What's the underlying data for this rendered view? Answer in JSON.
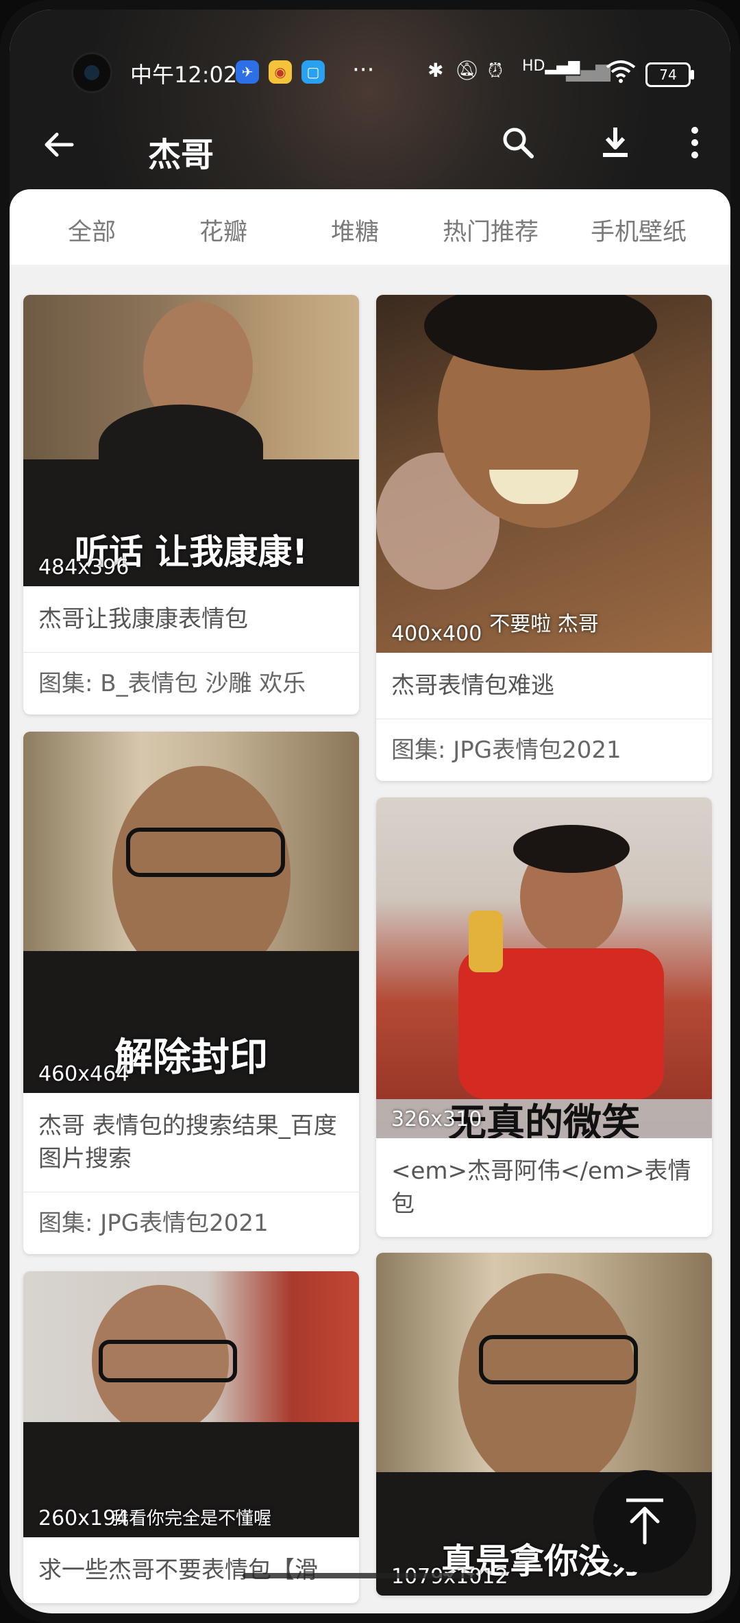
{
  "status_bar": {
    "time": "中午12:02",
    "app_icons": [
      "maps-icon",
      "weibo-icon",
      "message-icon"
    ],
    "overflow": "···",
    "battery": "74",
    "signal_label": "HD"
  },
  "header": {
    "back_icon": "arrow-left-icon",
    "title": "杰哥",
    "actions": [
      "search-icon",
      "download-icon",
      "more-vertical-icon"
    ]
  },
  "tabs": [
    "全部",
    "花瓣",
    "堆糖",
    "热门推荐",
    "手机壁纸"
  ],
  "cards": [
    {
      "dims": "484x396",
      "caption": "听话 让我康康!",
      "title": "杰哥让我康康表情包",
      "subtitle": "图集: B_表情包 沙雕 欢乐"
    },
    {
      "dims": "400x400",
      "caption": "不要啦 杰哥",
      "title": "杰哥表情包难逃",
      "subtitle": "图集: JPG表情包2021"
    },
    {
      "dims": "460x464",
      "caption": "解除封印",
      "title": "杰哥 表情包的搜索结果_百度图片搜索",
      "subtitle": "图集: JPG表情包2021"
    },
    {
      "dims": "326x310",
      "caption": "无真的微笑",
      "title": "<em>杰哥阿伟</em>表情包",
      "subtitle": ""
    },
    {
      "dims": "260x194",
      "caption": "我看你完全是不懂喔",
      "title": "求一些杰哥不要表情包【滑",
      "subtitle": ""
    },
    {
      "dims": "1079x1012",
      "caption": "真是拿你没办",
      "title": "",
      "subtitle": ""
    }
  ],
  "fab": {
    "icon": "scroll-to-top-icon"
  },
  "colors": {
    "tab_bg": "#ffffff",
    "page_bg": "#f1f1f1",
    "fab_bg": "#111111"
  }
}
